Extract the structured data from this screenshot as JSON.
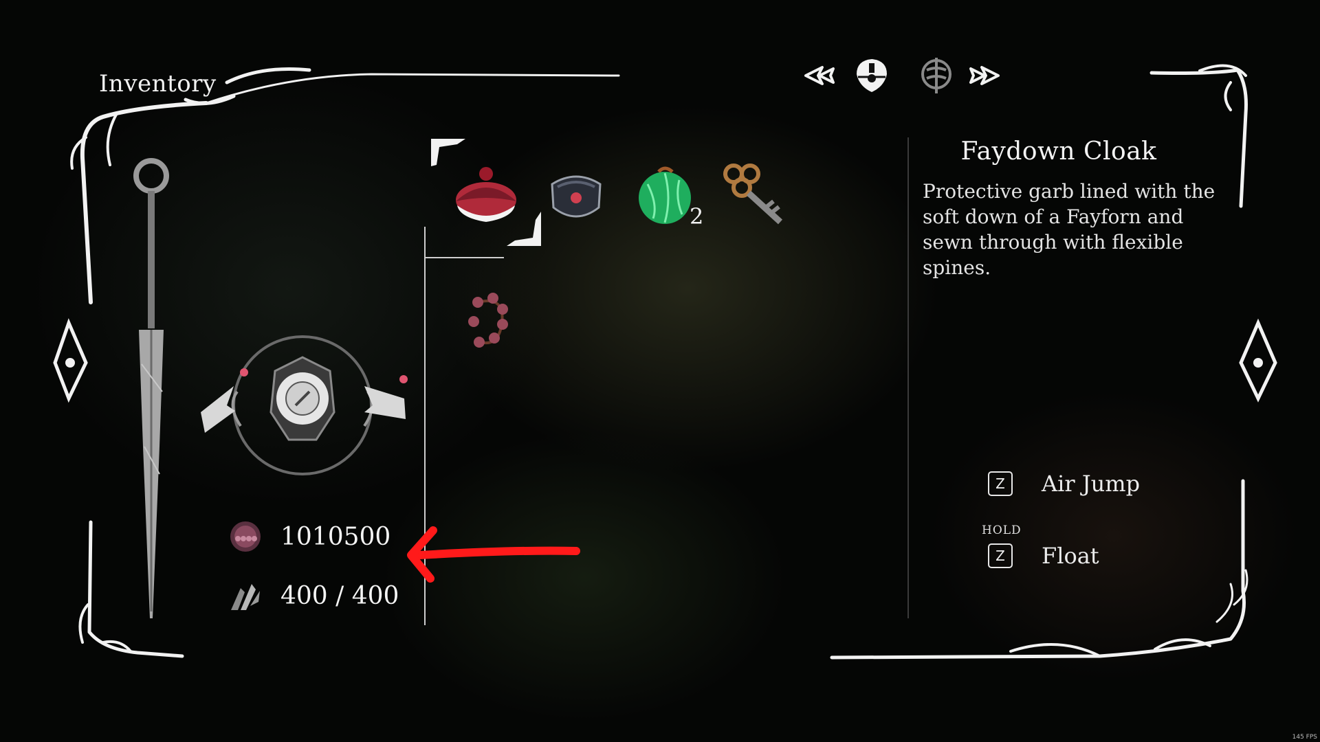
{
  "header": {
    "title": "Inventory",
    "tabs": [
      "tab-left-arrow-icon",
      "mask-icon",
      "map-icon",
      "tab-right-arrow-icon"
    ]
  },
  "stats": {
    "rosaries": "1010500",
    "shards": "400 / 400"
  },
  "items": [
    {
      "icon": "red-cap-icon",
      "count": ""
    },
    {
      "icon": "dark-pouch-icon",
      "count": ""
    },
    {
      "icon": "green-orb-icon",
      "count": "2"
    },
    {
      "icon": "ring-key-icon",
      "count": ""
    },
    {
      "icon": "bead-bracelet-icon",
      "count": ""
    }
  ],
  "details": {
    "name": "Faydown Cloak",
    "description": "Protective garb lined with the soft down of a Fayforn and sewn through with flexible spines."
  },
  "controls": {
    "air_jump": {
      "key": "Z",
      "label": "Air Jump"
    },
    "float": {
      "hold": "HOLD",
      "key": "Z",
      "label": "Float"
    }
  },
  "annotation": {
    "arrow_color": "#ff1a1a"
  },
  "footer": {
    "fps": "145 FPS"
  },
  "colors": {
    "frame": "#f2f2f2",
    "background": "#050605"
  }
}
